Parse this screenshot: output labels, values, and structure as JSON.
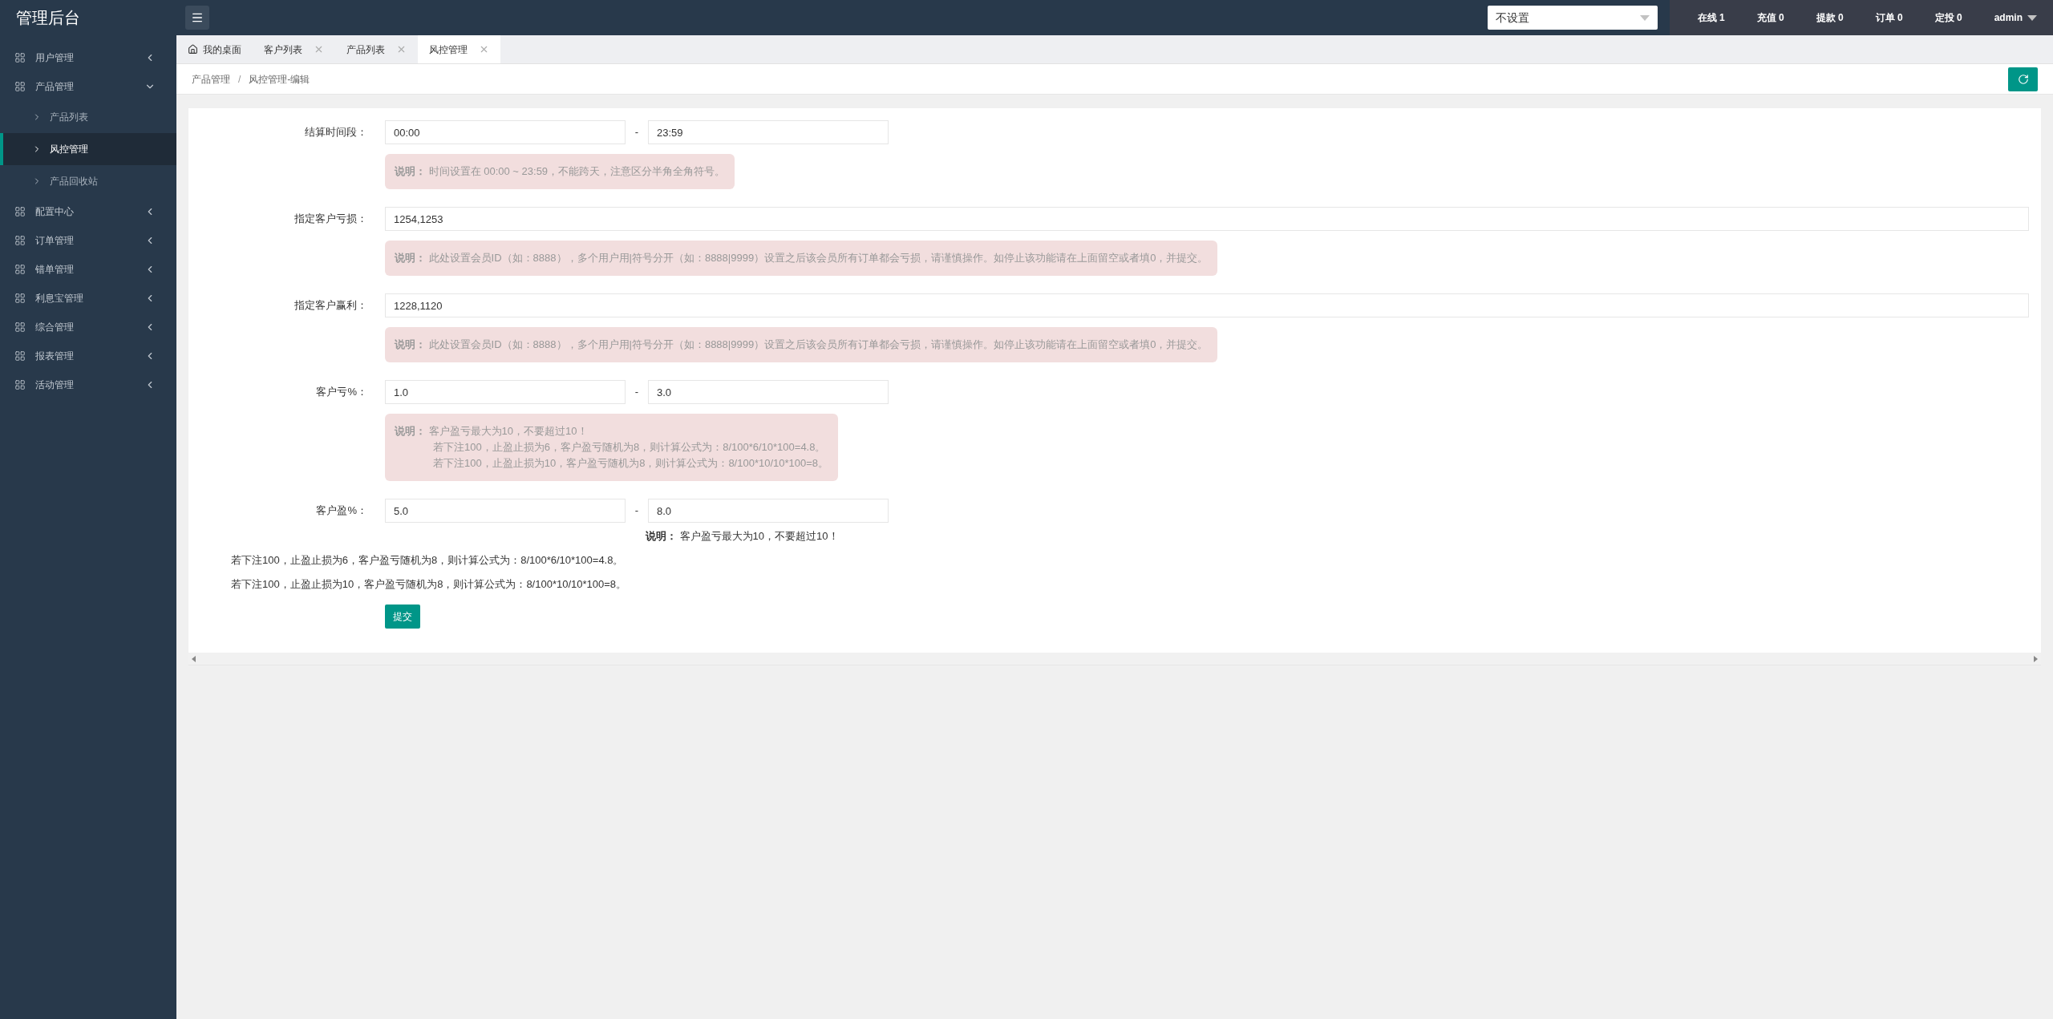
{
  "app_title": "管理后台",
  "sidebar": {
    "items": [
      {
        "label": "用户管理",
        "expanded": false
      },
      {
        "label": "产品管理",
        "expanded": true,
        "children": [
          {
            "label": "产品列表",
            "selected": false
          },
          {
            "label": "风控管理",
            "selected": true
          },
          {
            "label": "产品回收站",
            "selected": false
          }
        ]
      },
      {
        "label": "配置中心",
        "expanded": false
      },
      {
        "label": "订单管理",
        "expanded": false
      },
      {
        "label": "错单管理",
        "expanded": false
      },
      {
        "label": "利息宝管理",
        "expanded": false
      },
      {
        "label": "综合管理",
        "expanded": false
      },
      {
        "label": "报表管理",
        "expanded": false
      },
      {
        "label": "活动管理",
        "expanded": false
      }
    ]
  },
  "header": {
    "select_value": "不设置",
    "stats": [
      "在线 1",
      "充值 0",
      "提款 0",
      "订单 0",
      "定投 0"
    ],
    "user": "admin"
  },
  "tabs": [
    {
      "label": "我的桌面",
      "selected": false,
      "kind": "home"
    },
    {
      "label": "客户列表",
      "selected": false,
      "kind": "closable"
    },
    {
      "label": "产品列表",
      "selected": false,
      "kind": "closable"
    },
    {
      "label": "风控管理",
      "selected": true,
      "kind": "closable"
    }
  ],
  "breadcrumb": {
    "items": [
      "产品管理",
      "风控管理-编辑"
    ],
    "separator": "/"
  },
  "range_separator": "-",
  "form": {
    "rows": [
      {
        "kind": "range",
        "label": "结算时间段：",
        "from": "00:00",
        "to": "23:59",
        "note": [
          "**说明：** 时间设置在 00:00 ~ 23:59，不能跨天，注意区分半角全角符号。"
        ]
      },
      {
        "kind": "text",
        "label": "指定客户亏损：",
        "value": "1254,1253",
        "note": [
          "**说明：** 此处设置会员ID（如：8888），多个用户用|符号分开（如：8888|9999）设置之后该会员所有订单都会亏损，请谨慎操作。如停止该功能请在上面留空或者填0，并提交。"
        ]
      },
      {
        "kind": "text",
        "label": "指定客户赢利：",
        "value": "1228,1120",
        "note": [
          "**说明：** 此处设置会员ID（如：8888），多个用户用|符号分开（如：8888|9999）设置之后该会员所有订单都会亏损，请谨慎操作。如停止该功能请在上面留空或者填0，并提交。"
        ]
      },
      {
        "kind": "range",
        "label": "客户亏%：",
        "from": "1.0",
        "to": "3.0",
        "note": [
          "**说明：** 客户盈亏最大为10，不要超过10！",
          "若下注100，止盈止损为6，客户盈亏随机为8，则计算公式为：8/100*6/10*100=4.8。",
          "若下注100，止盈止损为10，客户盈亏随机为8，则计算公式为：8/100*10/10*100=8。"
        ]
      },
      {
        "kind": "range",
        "label": "客户盈%：",
        "from": "5.0",
        "to": "8.0",
        "plain_note": "**说明：** 客户盈亏最大为10，不要超过10！",
        "extra_lines": [
          "若下注100，止盈止损为6，客户盈亏随机为8，则计算公式为：8/100*6/10*100=4.8。",
          "若下注100，止盈止损为10，客户盈亏随机为8，则计算公式为：8/100*10/10*100=8。"
        ]
      }
    ],
    "submit": "提交"
  }
}
